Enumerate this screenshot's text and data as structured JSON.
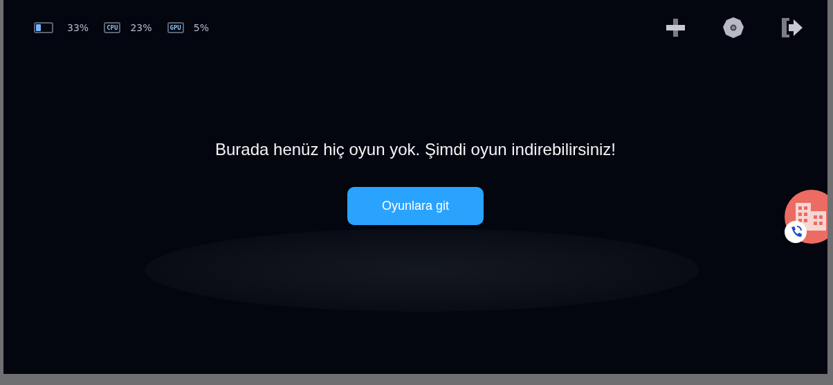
{
  "status": {
    "battery": {
      "reading": "33%"
    },
    "cpu": {
      "label": "CPU",
      "reading": "23%"
    },
    "gpu": {
      "label": "GPU",
      "reading": "5%"
    }
  },
  "message": "Burada henüz hiç oyun yok. Şimdi oyun indirebilirsiniz!",
  "button": "Oyunlara git"
}
